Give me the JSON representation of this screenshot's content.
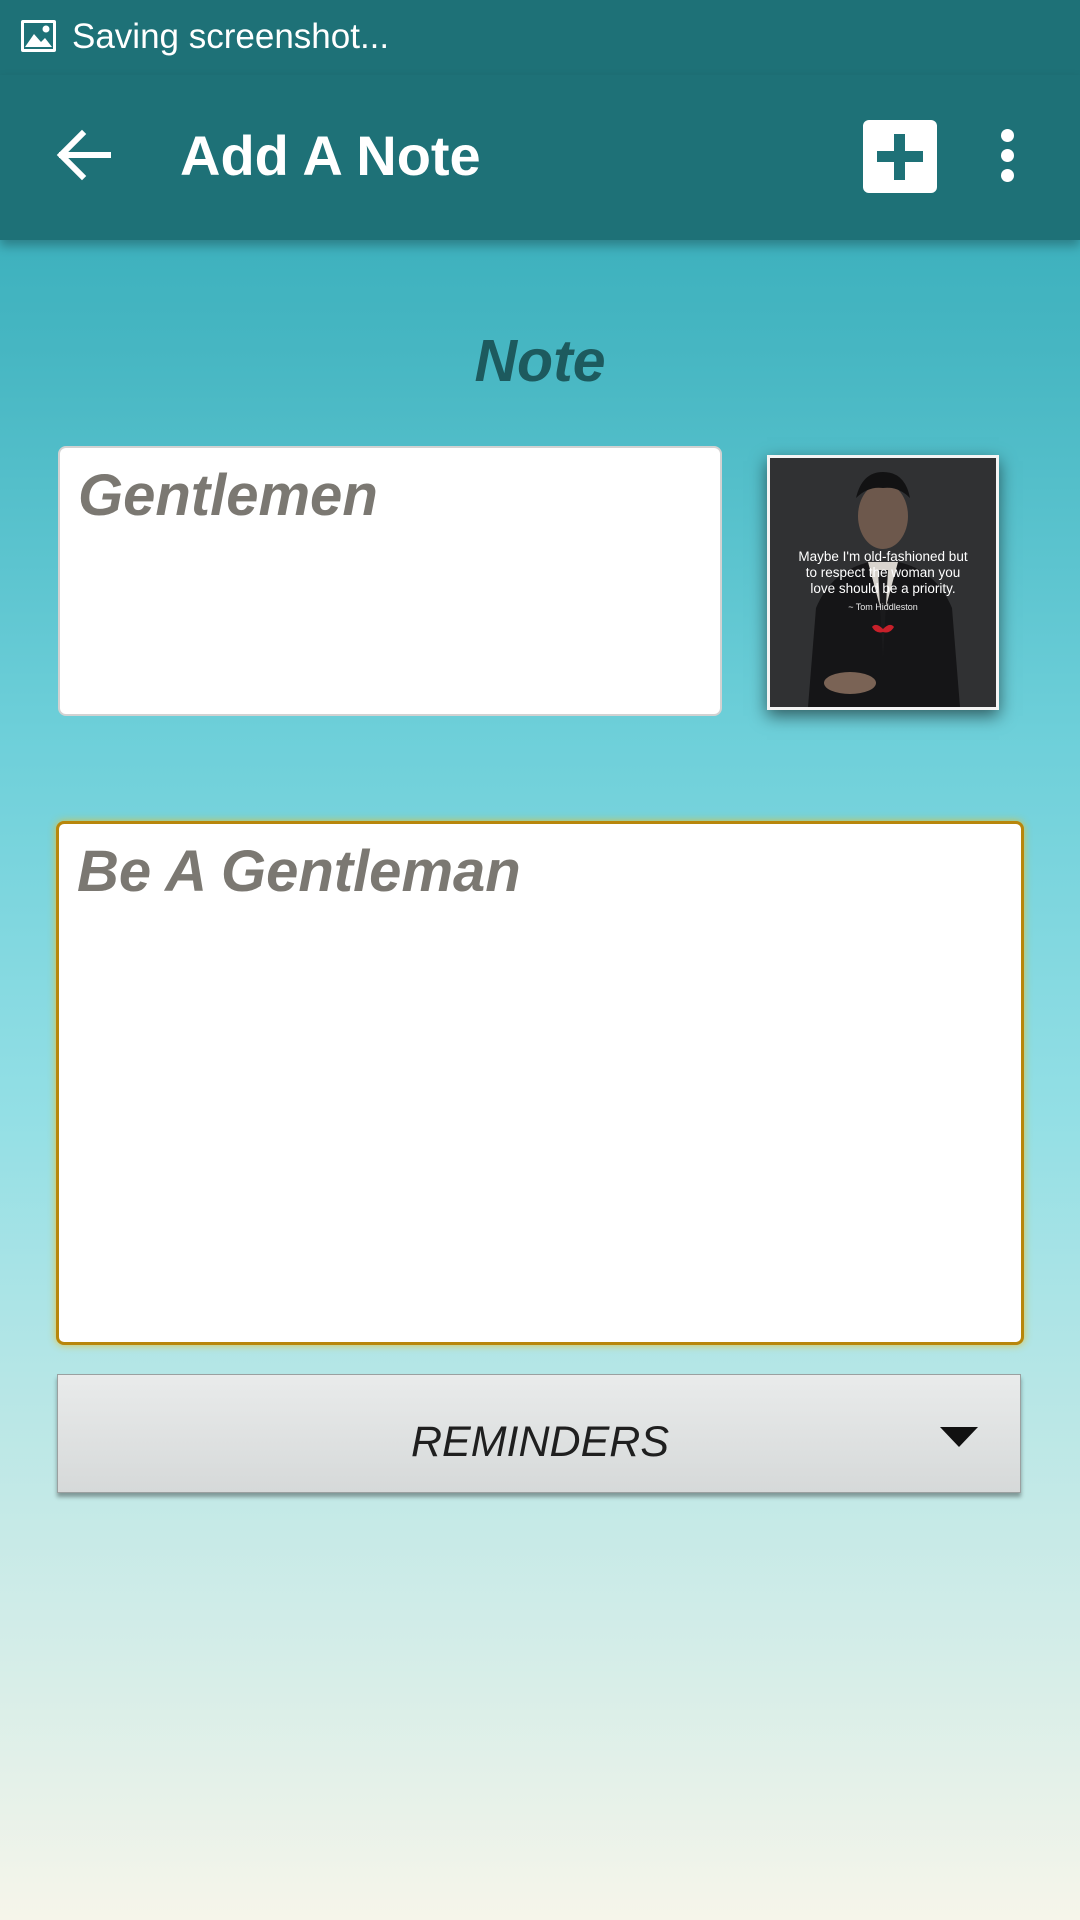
{
  "status_bar": {
    "icon": "image-icon",
    "text": "Saving screenshot..."
  },
  "app_bar": {
    "title": "Add A Note",
    "back_icon": "arrow-left-icon",
    "add_icon": "plus-square-icon",
    "more_icon": "more-vertical-icon",
    "color": "#1e7177"
  },
  "main": {
    "section_title": "Note",
    "title_field": {
      "value": "Gentlemen"
    },
    "image": {
      "caption_line1": "Maybe I'm old-fashioned but",
      "caption_line2": "to respect the woman you",
      "caption_line3": "love should be a priority.",
      "author": "~ Tom Hiddleston"
    },
    "body_field": {
      "value": "Be A Gentleman"
    },
    "reminders": {
      "label": "REMINDERS",
      "icon": "caret-down-icon"
    }
  },
  "colors": {
    "bar": "#1e7177",
    "section_title": "#1d5a5e",
    "field_text": "#7b7872",
    "focus_border": "#b8860b"
  }
}
